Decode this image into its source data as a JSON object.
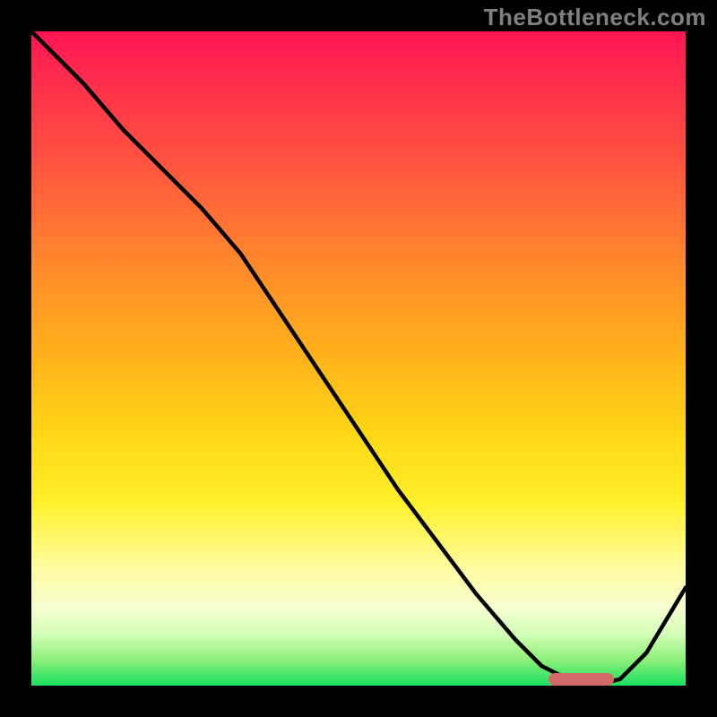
{
  "watermark": "TheBottleneck.com",
  "colors": {
    "frame": "#000000",
    "watermark": "#808080",
    "curve": "#000000",
    "marker": "#d26a6a",
    "gradient_stops": [
      "#ff1452",
      "#ff2f4c",
      "#ff5a3e",
      "#ff8a2a",
      "#ffb31a",
      "#ffd816",
      "#fff02a",
      "#fffca0",
      "#f6ffd0",
      "#d4ffb8",
      "#8ff07a",
      "#18e060"
    ]
  },
  "chart_data": {
    "type": "line",
    "title": "",
    "xlabel": "",
    "ylabel": "",
    "xlim": [
      0,
      100
    ],
    "ylim": [
      0,
      100
    ],
    "series": [
      {
        "name": "bottleneck-curve",
        "x": [
          0,
          8,
          14,
          20,
          26,
          32,
          38,
          44,
          50,
          56,
          62,
          68,
          74,
          78,
          82,
          86,
          90,
          94,
          100
        ],
        "values": [
          100,
          92,
          85,
          79,
          73,
          66,
          57,
          48,
          39,
          30,
          22,
          14,
          7,
          3,
          1,
          0,
          1,
          5,
          15
        ]
      }
    ],
    "annotations": [
      {
        "name": "optimal-range-marker",
        "x_start": 79,
        "x_end": 89,
        "y": 0
      }
    ]
  }
}
